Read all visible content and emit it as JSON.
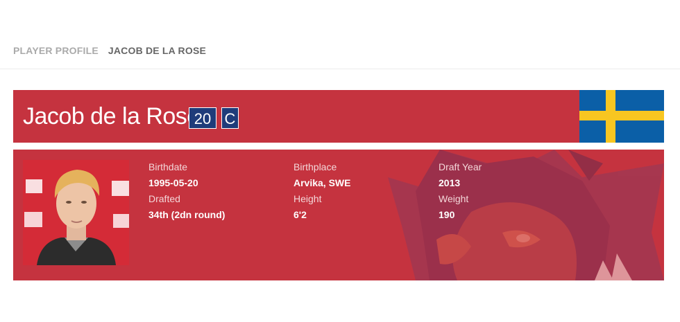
{
  "breadcrumb": {
    "root": "PLAYER PROFILE",
    "current": "JACOB DE LA ROSE"
  },
  "player": {
    "name": "Jacob de la Rose",
    "number": "20",
    "position": "C",
    "country_flag": "sweden-flag-icon"
  },
  "details": {
    "birthdate_label": "Birthdate",
    "birthdate": "1995-05-20",
    "birthplace_label": "Birthplace",
    "birthplace": "Arvika, SWE",
    "draft_year_label": "Draft Year",
    "draft_year": "2013",
    "drafted_label": "Drafted",
    "drafted": "34th (2dn round)",
    "height_label": "Height",
    "height": "6'2",
    "weight_label": "Weight",
    "weight": "190"
  },
  "colors": {
    "team_red": "#c5333f",
    "badge_blue": "#1f3c7a",
    "flag_blue": "#0b5fa7",
    "flag_yellow": "#f8c621"
  }
}
